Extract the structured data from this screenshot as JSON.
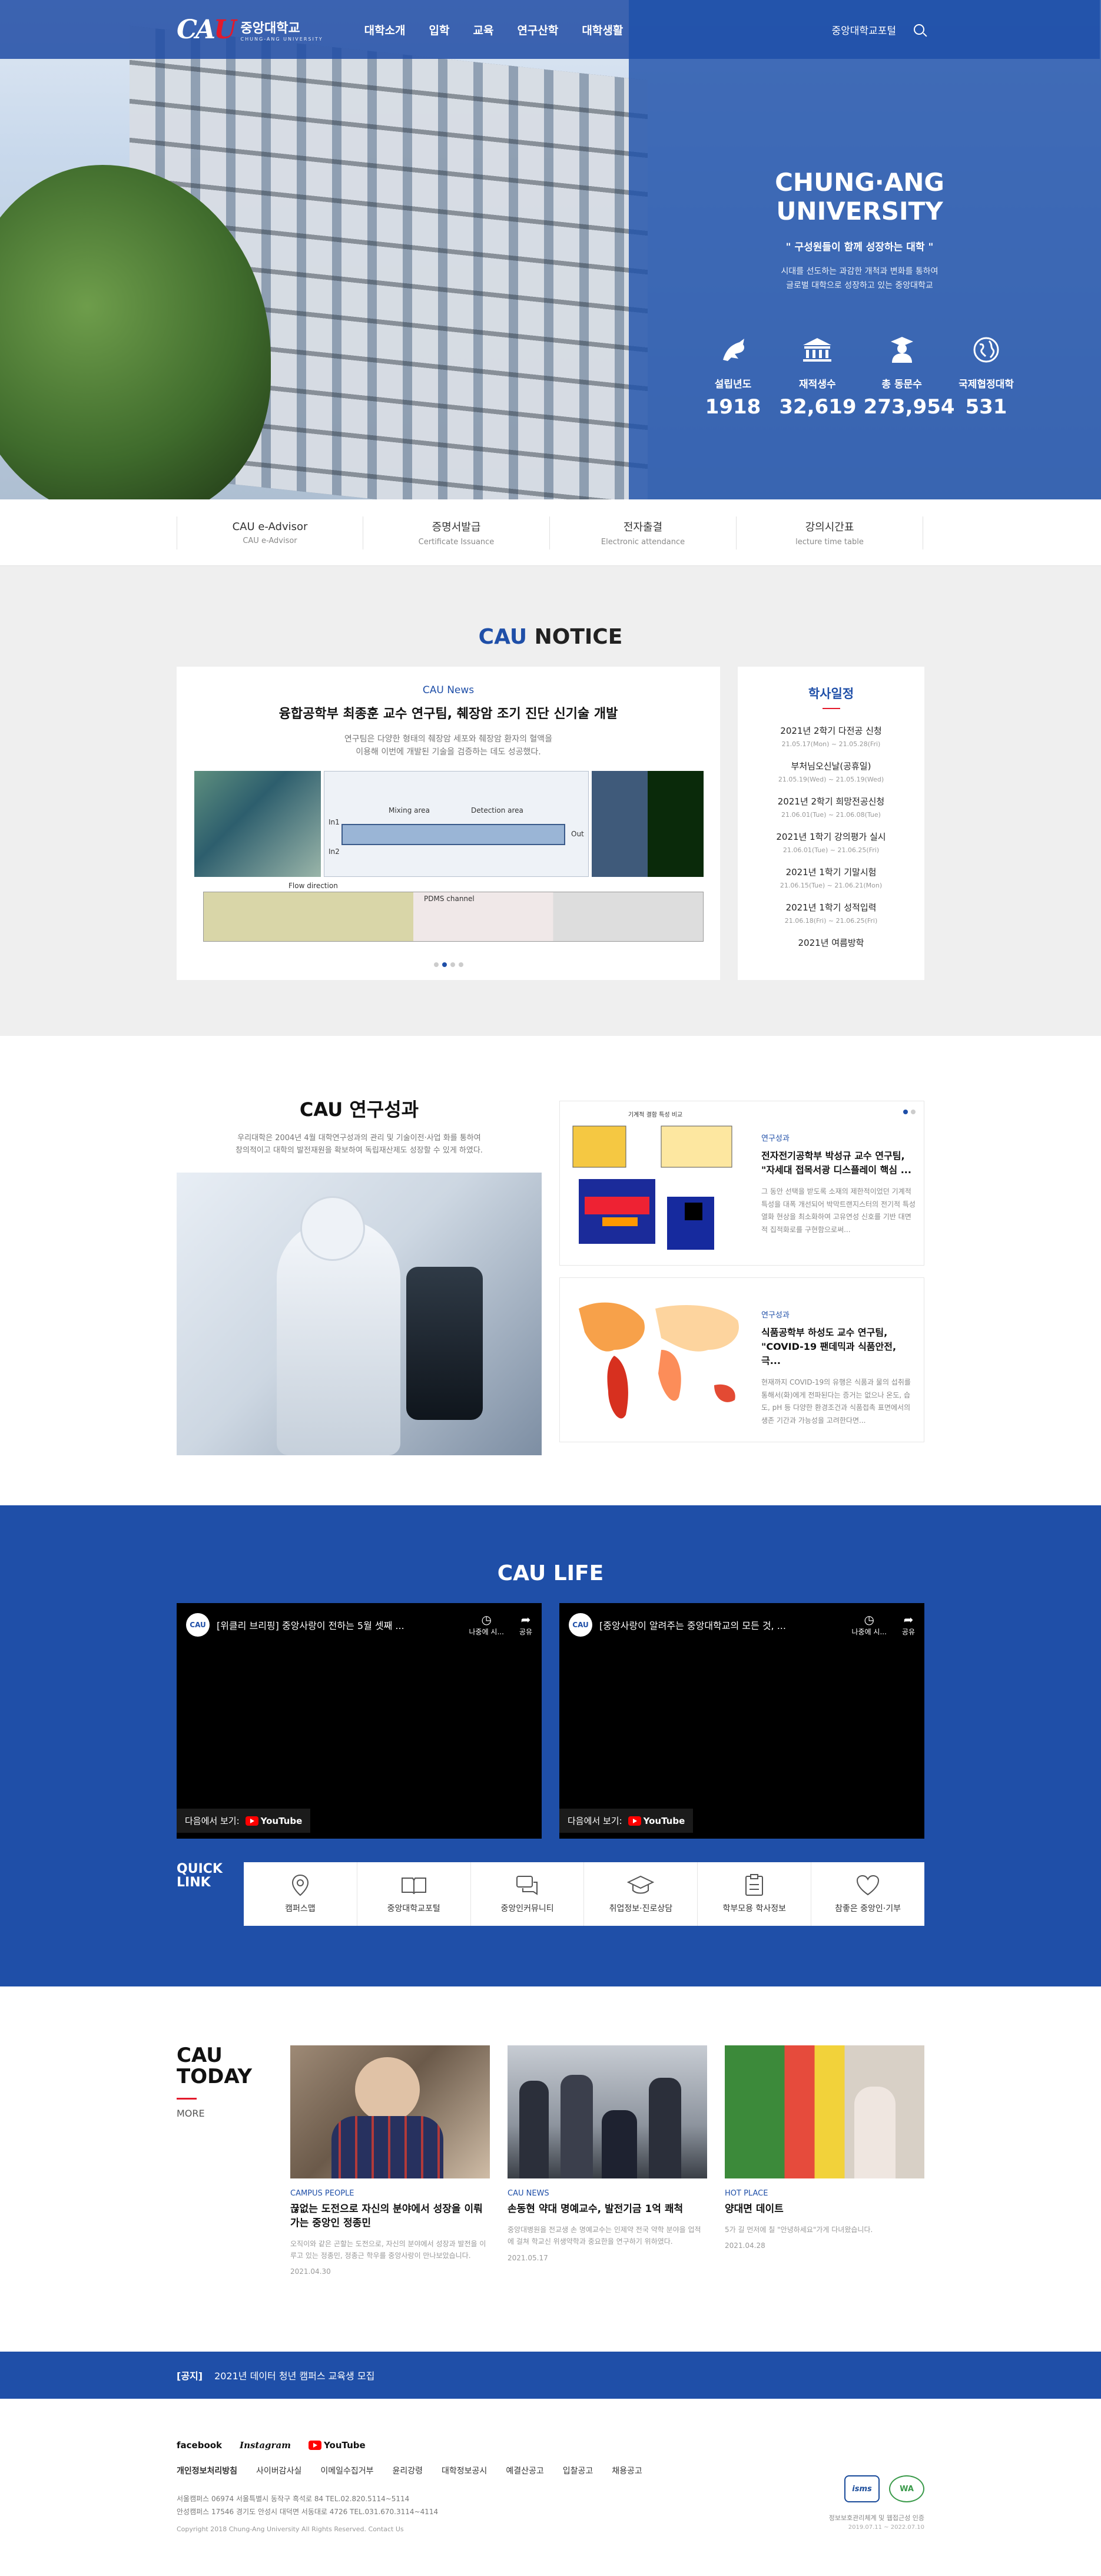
{
  "header": {
    "logo_mark": "CAU",
    "logo_kr": "중앙대학교",
    "logo_en": "CHUNG-ANG UNIVERSITY",
    "nav": [
      "대학소개",
      "입학",
      "교육",
      "연구산학",
      "대학생활"
    ],
    "portal": "중앙대학교포털"
  },
  "hero": {
    "title": "CHUNG·ANG UNIVERSITY",
    "slogan": "\" 구성원들이 함께 성장하는 대학 \"",
    "desc_1": "시대를 선도하는 과감한 개척과 변화를 통하여",
    "desc_2": "글로벌 대학으로 성장하고 있는 중앙대학교",
    "stats": [
      {
        "label": "설립년도",
        "value": "1918",
        "icon": "dragon-icon"
      },
      {
        "label": "재적생수",
        "value": "32,619",
        "icon": "building-icon"
      },
      {
        "label": "총 동문수",
        "value": "273,954",
        "icon": "graduate-icon"
      },
      {
        "label": "국제협정대학",
        "value": "531",
        "icon": "globe-icon"
      }
    ]
  },
  "services": [
    {
      "title": "CAU e-Advisor",
      "sub": "CAU e-Advisor"
    },
    {
      "title": "증명서발급",
      "sub": "Certificate Issuance"
    },
    {
      "title": "전자출결",
      "sub": "Electronic attendance"
    },
    {
      "title": "강의시간표",
      "sub": "lecture time table"
    }
  ],
  "notice": {
    "title_accent": "CAU",
    "title_rest": " NOTICE",
    "news": {
      "category": "CAU News",
      "headline": "융합공학부 최종훈 교수 연구팀, 췌장암 조기 진단 신기술 개발",
      "desc_1": "연구팀은 다양한 형태의 췌장암 세포와 췌장암 환자의 혈액을",
      "desc_2": "이용해 이번에 개발된 기술을 검증하는 데도 성공했다.",
      "fig_labels": [
        "Mixing area",
        "Detection area",
        "Flow direction",
        "PDMS channel",
        "Out",
        "In1",
        "In2"
      ]
    },
    "academic": {
      "title": "학사일정",
      "items": [
        {
          "t": "2021년 2학기 다전공 신청",
          "d": "21.05.17(Mon) ~ 21.05.28(Fri)"
        },
        {
          "t": "부처님오신날(공휴일)",
          "d": "21.05.19(Wed) ~ 21.05.19(Wed)"
        },
        {
          "t": "2021년 2학기 희망전공신청",
          "d": "21.06.01(Tue) ~ 21.06.08(Tue)"
        },
        {
          "t": "2021년 1학기 강의평가 실시",
          "d": "21.06.01(Tue) ~ 21.06.25(Fri)"
        },
        {
          "t": "2021년 1학기 기말시험",
          "d": "21.06.15(Tue) ~ 21.06.21(Mon)"
        },
        {
          "t": "2021년 1학기 성적입력",
          "d": "21.06.18(Fri) ~ 21.06.25(Fri)"
        },
        {
          "t": "2021년 여름방학",
          "d": ""
        }
      ]
    }
  },
  "research": {
    "title": "CAU 연구성과",
    "desc_1": "우리대학은 2004년 4월 대학연구성과의 관리 및 기술이전·사업 화를 통하여",
    "desc_2": "창의적이고 대학의 발전재원을 확보하여 독립재산제도 성장할 수 있게 하였다.",
    "cards": [
      {
        "cat": "연구성과",
        "title_1": "전자전기공학부 박성규 교수 연구팀,",
        "title_2": "\"자세대 접목서광 디스플레이 핵심 ...",
        "body": "그 동안 선택을 받도록 소재의 제한적이었던 기계적 특성을 대폭 개선되어 박막트랜지스터의 전기적 특성 열화 현상을 최소화하여 고유연성 신호를 기반 대면적 집적화로를 구현함으로써...",
        "fig_title": "기계적 결함 특성 비교"
      },
      {
        "cat": "연구성과",
        "title_1": "식품공학부 하성도 교수 연구팀,",
        "title_2": "\"COVID-19 팬데믹과 식품안전, 극...",
        "body": "현재까지 COVID-19의 유행은 식품과 물의 섭취를 통해서(화)에게 전파된다는 증거는 없으나 온도, 습도, pH 등 다양한 환경조건과 식품접촉 표면에서의 생존 기간과 가능성을 고려한다면...",
        "fig_title": ""
      }
    ]
  },
  "life": {
    "title_accent": "CAU",
    "title_rest": " LIFE",
    "videos": [
      {
        "title": "[위클리 브리핑] 중앙사랑이 전하는 5월 셋째 ...",
        "watch_later": "나중에 시...",
        "share": "공유",
        "watch_on": "다음에서 보기:",
        "yt": "YouTube"
      },
      {
        "title": "[중앙사랑이 알려주는 중앙대학교의 모든 것, ...",
        "watch_later": "나중에 시...",
        "share": "공유",
        "watch_on": "다음에서 보기:",
        "yt": "YouTube"
      }
    ],
    "quick_label_1": "QUICK",
    "quick_label_2": "LINK",
    "quick_links": [
      {
        "t": "캠퍼스맵",
        "icon": "map-pin-icon"
      },
      {
        "t": "중앙대학교포털",
        "icon": "book-icon"
      },
      {
        "t": "중앙인커뮤니티",
        "icon": "chat-icon"
      },
      {
        "t": "취업정보·진로상담",
        "icon": "graduation-cap-icon"
      },
      {
        "t": "학부모용 학사정보",
        "icon": "clipboard-icon"
      },
      {
        "t": "참좋은 중앙인·기부",
        "icon": "heart-icon"
      }
    ]
  },
  "today": {
    "title_1": "CAU",
    "title_2": "TODAY",
    "more": "MORE",
    "cards": [
      {
        "cat": "CAMPUS PEOPLE",
        "title": "끊없는 도전으로 자신의 분야에서 성장을 이뤄가는 중앙인 정종민",
        "body": "오직이와 같은 곤할는 도전으로, 자신의 분야에서 성장과 발전을 이루고 있는 정종민, 정종근 학우를 중앙사랑이 만나보았습니다.",
        "date": "2021.04.30"
      },
      {
        "cat": "CAU NEWS",
        "title": "손동현 약대 명예교수, 발전기금 1억 쾌척",
        "body": "중앙대병원을 전교생 손 명예교수는 인제약 전국 약학 분야을 업적에 걸쳐 학교신 위생약학과 중요한을 연구하기 위하였다.",
        "date": "2021.05.17"
      },
      {
        "cat": "HOT PLACE",
        "title": "양대면 데이트",
        "body": "5가 길 먼저에 칠 \"안녕하세요\"가게 다녀왔습니다.",
        "date": "2021.04.28"
      }
    ]
  },
  "notice_bar": {
    "tag": "[공지]",
    "text": "2021년 데이터 청년 캠퍼스 교육생 모집"
  },
  "footer": {
    "sns": [
      "facebook",
      "Instagram",
      "YouTube"
    ],
    "links": [
      "개인정보처리방침",
      "사이버감사실",
      "이메일수집거부",
      "윤리강령",
      "대학정보공시",
      "예결산공고",
      "입찰공고",
      "채용공고"
    ],
    "addr_1": "서울캠퍼스 06974 서울특별시 동작구 흑석로 84 TEL.02.820.5114~5114",
    "addr_2": "안성캠퍼스 17546 경기도 안성시 대덕면 서동대로 4726 TEL.031.670.3114~4114",
    "copyright": "Copyright 2018 Chung-Ang University All Rights Reserved. Contact Us",
    "cert_1": "isms",
    "cert_2": "WA",
    "cert_note": "정보보호관리체계 및 웹접근성 인증",
    "cert_date": "2019.07.11 ~ 2022.07.10"
  }
}
